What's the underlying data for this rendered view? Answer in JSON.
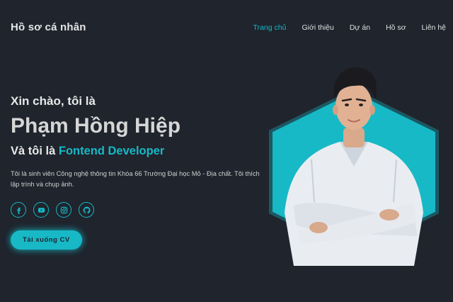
{
  "header": {
    "logo": "Hồ sơ cá nhân",
    "nav": [
      {
        "label": "Trang chủ",
        "active": true
      },
      {
        "label": "Giới thiệu",
        "active": false
      },
      {
        "label": "Dự án",
        "active": false
      },
      {
        "label": "Hồ sơ",
        "active": false
      },
      {
        "label": "Liên hệ",
        "active": false
      }
    ]
  },
  "home": {
    "greeting": "Xin chào, tôi là",
    "name": "Phạm Hồng Hiệp",
    "role_prefix": "Và tôi là ",
    "role": "Fontend Developer",
    "description": "Tôi là sinh viên Công nghệ thông tin Khóa 66 Trường Đại học Mỏ - Địa chất. Tôi thích lập trình và chụp ảnh.",
    "socials": [
      "facebook-icon",
      "youtube-icon",
      "instagram-icon",
      "github-icon"
    ],
    "cv_button": "Tải xuống CV"
  },
  "colors": {
    "background": "#1f242d",
    "accent": "#17b9c6"
  }
}
